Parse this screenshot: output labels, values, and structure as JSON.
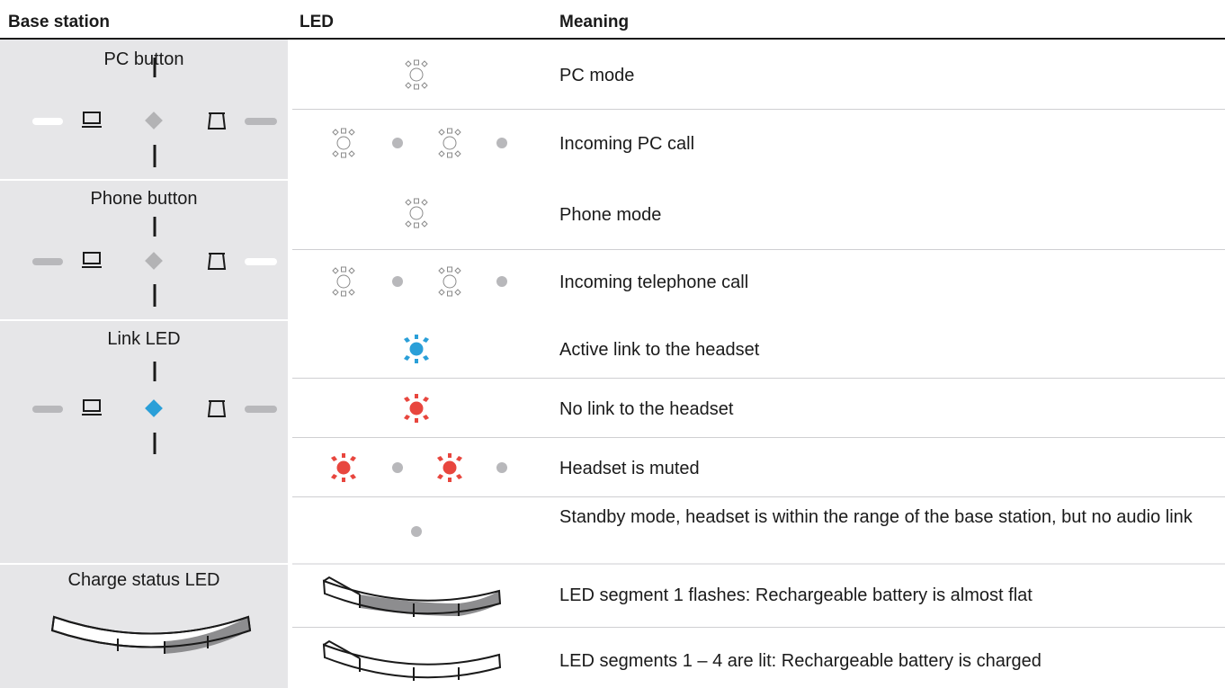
{
  "headers": {
    "base_station": "Base station",
    "led": "LED",
    "meaning": "Meaning"
  },
  "groups": [
    {
      "title": "PC button",
      "highlight": "pc-led",
      "highlight_color": "#ffffff",
      "rows": [
        {
          "led": "white-steady",
          "meaning": "PC mode"
        },
        {
          "led": "white-flash",
          "meaning": "Incoming PC call"
        }
      ]
    },
    {
      "title": "Phone button",
      "highlight": "phone-led",
      "highlight_color": "#ffffff",
      "rows": [
        {
          "led": "white-steady",
          "meaning": "Phone mode"
        },
        {
          "led": "white-flash",
          "meaning": "Incoming telephone call"
        }
      ]
    },
    {
      "title": "Link LED",
      "highlight": "link-led",
      "highlight_color": "#2a9fd8",
      "rows": [
        {
          "led": "blue-steady",
          "meaning": "Active link to the headset"
        },
        {
          "led": "red-steady",
          "meaning": "No link to the headset"
        },
        {
          "led": "red-flash",
          "meaning": "Headset is muted"
        },
        {
          "led": "grey-dot",
          "meaning": "Standby mode, headset is within the range of the base station, but no audio link"
        }
      ]
    },
    {
      "title": "Charge status LED",
      "rows": [
        {
          "led": "charge-segment-1",
          "meaning": "LED segment 1 flashes: Rechargeable battery is almost flat"
        },
        {
          "led": "charge-segments-all",
          "meaning": "LED segments 1 – 4 are lit: Rechargeable battery is charged"
        }
      ]
    }
  ],
  "colors": {
    "panel": "#e6e6e8",
    "blue": "#2a9fd8",
    "red": "#e8463e",
    "grey": "#b8b8bb",
    "dark_segment": "#8d8d8f"
  }
}
